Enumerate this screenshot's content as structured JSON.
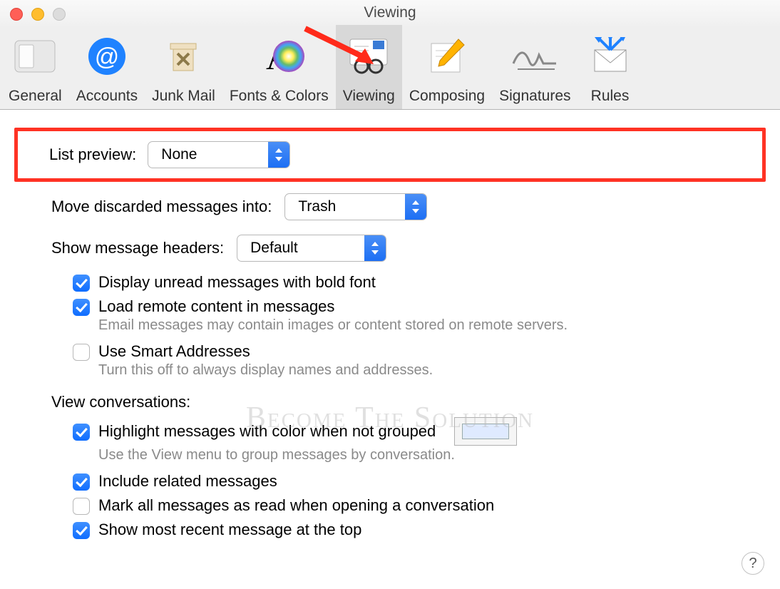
{
  "window": {
    "title": "Viewing"
  },
  "toolbar": {
    "tabs": [
      {
        "id": "general",
        "label": "General"
      },
      {
        "id": "accounts",
        "label": "Accounts"
      },
      {
        "id": "junk",
        "label": "Junk Mail"
      },
      {
        "id": "fonts",
        "label": "Fonts & Colors"
      },
      {
        "id": "viewing",
        "label": "Viewing"
      },
      {
        "id": "composing",
        "label": "Composing"
      },
      {
        "id": "signatures",
        "label": "Signatures"
      },
      {
        "id": "rules",
        "label": "Rules"
      }
    ],
    "active": "viewing"
  },
  "settings": {
    "list_preview": {
      "label": "List preview:",
      "value": "None"
    },
    "move_discarded": {
      "label": "Move discarded messages into:",
      "value": "Trash"
    },
    "message_headers": {
      "label": "Show message headers:",
      "value": "Default"
    },
    "display_unread": {
      "label": "Display unread messages with bold font",
      "checked": true
    },
    "load_remote": {
      "label": "Load remote content in messages",
      "checked": true,
      "desc": "Email messages may contain images or content stored on remote servers."
    },
    "smart_addresses": {
      "label": "Use Smart Addresses",
      "checked": false,
      "desc": "Turn this off to always display names and addresses."
    },
    "view_conversations": {
      "label": "View conversations:"
    },
    "highlight_color": {
      "label": "Highlight messages with color when not grouped",
      "checked": true,
      "desc": "Use the View menu to group messages by conversation."
    },
    "include_related": {
      "label": "Include related messages",
      "checked": true
    },
    "mark_read": {
      "label": "Mark all messages as read when opening a conversation",
      "checked": false
    },
    "show_recent": {
      "label": "Show most recent message at the top",
      "checked": true
    }
  },
  "help_button": "?",
  "watermark": "Become The Solution",
  "colors": {
    "highlight_swatch": "#dfeaff",
    "accent": "#1d6ff4",
    "annotation": "#ff3224"
  }
}
